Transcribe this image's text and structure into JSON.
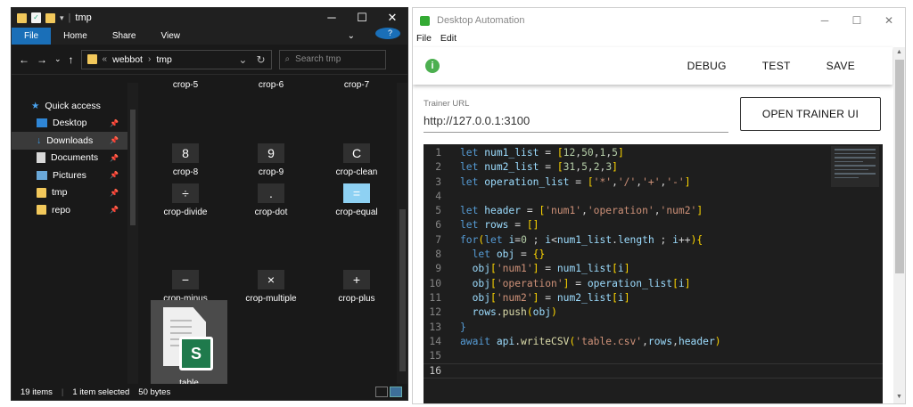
{
  "explorer": {
    "title": "tmp",
    "ribbon_tabs": [
      "File",
      "Home",
      "Share",
      "View"
    ],
    "breadcrumb": [
      "webbot",
      "tmp"
    ],
    "search_placeholder": "Search tmp",
    "nav_items": [
      {
        "label": "Quick access",
        "icon": "star-icon"
      },
      {
        "label": "Desktop",
        "icon": "desktop-icon",
        "pinned": true
      },
      {
        "label": "Downloads",
        "icon": "download-icon",
        "pinned": true,
        "selected": true
      },
      {
        "label": "Documents",
        "icon": "documents-icon",
        "pinned": true
      },
      {
        "label": "Pictures",
        "icon": "pictures-icon",
        "pinned": true
      },
      {
        "label": "tmp",
        "icon": "folder-icon",
        "pinned": true
      },
      {
        "label": "repo",
        "icon": "folder-icon",
        "pinned": true
      }
    ],
    "top_partial_labels": [
      "crop-5",
      "crop-6",
      "crop-7"
    ],
    "files": [
      {
        "label": "crop-8",
        "glyph": "8"
      },
      {
        "label": "crop-9",
        "glyph": "9"
      },
      {
        "label": "crop-clean",
        "glyph": "C"
      },
      {
        "label": "crop-divide",
        "glyph": "÷"
      },
      {
        "label": "crop-dot",
        "glyph": "."
      },
      {
        "label": "crop-equal",
        "glyph": "="
      },
      {
        "label": "crop-minus",
        "glyph": "−"
      },
      {
        "label": "crop-multiple",
        "glyph": "×"
      },
      {
        "label": "crop-plus",
        "glyph": "+"
      }
    ],
    "selected_file": {
      "label": "table",
      "badge": "S"
    },
    "status": {
      "count": "19 items",
      "selection": "1 item selected",
      "size": "50 bytes"
    },
    "accent": "#1a6fb8"
  },
  "automation": {
    "title": "Desktop Automation",
    "menu": [
      "File",
      "Edit"
    ],
    "status_icon": "info-icon",
    "actions": [
      "DEBUG",
      "TEST",
      "SAVE"
    ],
    "trainer_label": "Trainer URL",
    "trainer_url": "http://127.0.0.1:3100",
    "open_button": "OPEN TRAINER UI",
    "code_lines": [
      "let num1_list = [12,50,1,5]",
      "let num2_list = [31,5,2,3]",
      "let operation_list = ['*','/','+','-']",
      "",
      "let header = ['num1','operation','num2']",
      "let rows = []",
      "for(let i=0 ; i<num1_list.length ; i++){",
      "  let obj = {}",
      "  obj['num1'] = num1_list[i]",
      "  obj['operation'] = operation_list[i]",
      "  obj['num2'] = num2_list[i]",
      "  rows.push(obj)",
      "}",
      "await api.writeCSV('table.csv',rows,header)",
      "",
      ""
    ],
    "current_line": 16,
    "accent_green": "#4caf50"
  }
}
